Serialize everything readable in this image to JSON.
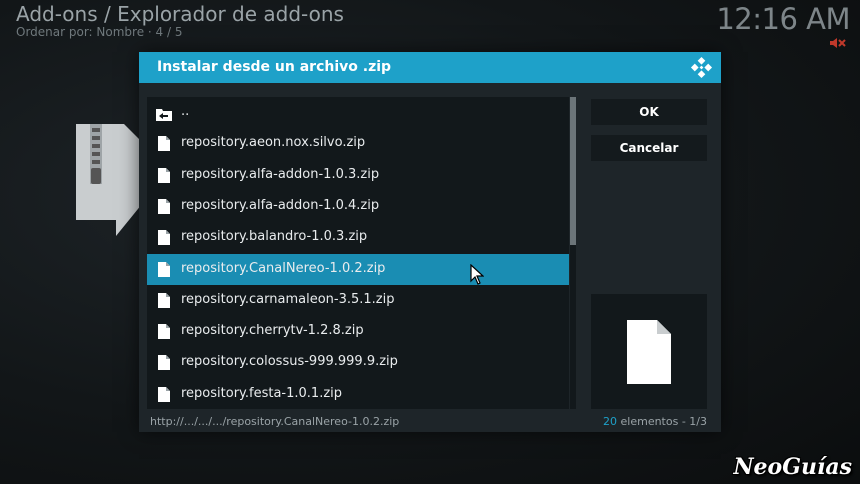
{
  "header": {
    "title": "Add-ons / Explorador de add-ons",
    "sort": "Ordenar por: Nombre  ·  4 / 5",
    "clock": "12:16 AM"
  },
  "dialog": {
    "title": "Instalar desde un archivo .zip",
    "items": [
      {
        "label": "..",
        "icon": "folder-back-icon"
      },
      {
        "label": "repository.aeon.nox.silvo.zip",
        "icon": "file-icon"
      },
      {
        "label": "repository.alfa-addon-1.0.3.zip",
        "icon": "file-icon"
      },
      {
        "label": "repository.alfa-addon-1.0.4.zip",
        "icon": "file-icon"
      },
      {
        "label": "repository.balandro-1.0.3.zip",
        "icon": "file-icon"
      },
      {
        "label": "repository.CanalNereo-1.0.2.zip",
        "icon": "file-icon",
        "selected": true
      },
      {
        "label": "repository.carnamaleon-3.5.1.zip",
        "icon": "file-icon"
      },
      {
        "label": "repository.cherrytv-1.2.8.zip",
        "icon": "file-icon"
      },
      {
        "label": "repository.colossus-999.999.9.zip",
        "icon": "file-icon"
      },
      {
        "label": "repository.festa-1.0.1.zip",
        "icon": "file-icon"
      }
    ],
    "ok_label": "OK",
    "cancel_label": "Cancelar",
    "path": "http://.../.../.../repository.CanalNereo-1.0.2.zip",
    "count_number": "20",
    "count_text": " elementos - ",
    "page": "1/3"
  },
  "colors": {
    "accent": "#1ea1c9",
    "selected": "#1a8db3",
    "dialog_bg": "#1e2529",
    "panel_bg": "#12181b"
  },
  "watermark": "NeoGuías"
}
